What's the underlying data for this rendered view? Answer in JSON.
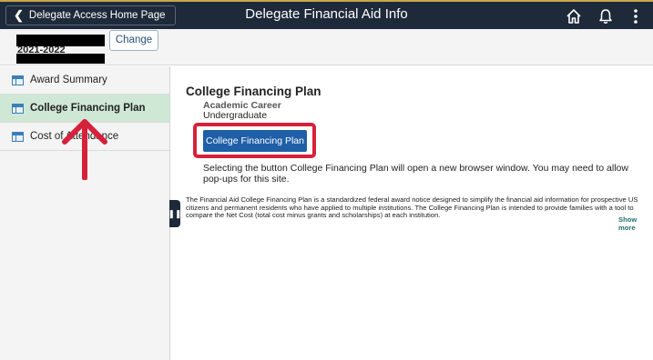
{
  "header": {
    "back_label": "Delegate Access Home Page",
    "title": "Delegate Financial Aid Info",
    "icons": [
      "home-icon",
      "bell-icon",
      "more-menu-icon"
    ]
  },
  "subheader": {
    "year": "2021-2022",
    "change_label": "Change"
  },
  "sidebar": {
    "items": [
      {
        "label": "Award Summary",
        "icon": "table-icon"
      },
      {
        "label": "College Financing Plan",
        "icon": "table-icon",
        "active": true
      },
      {
        "label": "Cost of Attendance",
        "icon": "table-icon"
      }
    ]
  },
  "main": {
    "title": "College Financing Plan",
    "career_label": "Academic Career",
    "career_value": "Undergraduate",
    "button_label": "College Financing Plan",
    "info": "Selecting the button College Financing Plan will open a new browser window. You may need to allow pop-ups for this site.",
    "description": "The Financial Aid College Financing Plan is a standardized federal award notice designed to simplify the financial aid information for prospective US citizens and permanent residents who have applied to multiple institutions. The College Financing Plan is intended to provide families with a tool to compare the Net Cost (total cost minus grants and scholarships) at each institution.",
    "show_more": "Show more"
  },
  "colors": {
    "header_bg": "#1e2a3a",
    "active_item_bg": "#cfe8d6",
    "button_bg": "#1f5fa8",
    "highlight_red": "#d6213a"
  }
}
